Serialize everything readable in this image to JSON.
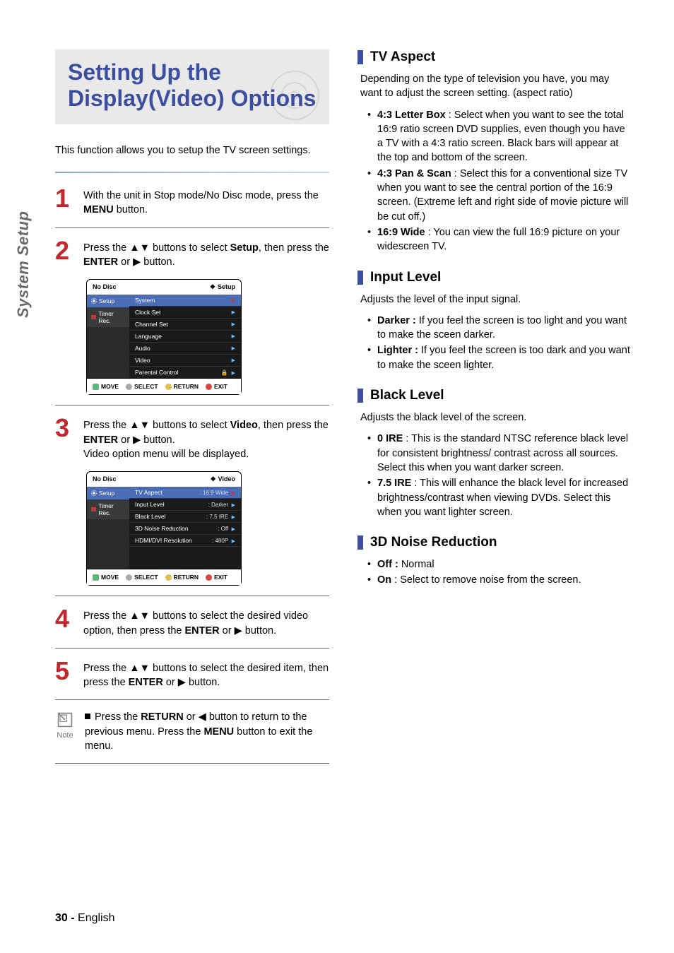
{
  "sideTab": "System Setup",
  "title": "Setting Up the Display(Video) Options",
  "intro": "This function allows you to setup the TV screen settings.",
  "steps": {
    "s1": {
      "num": "1",
      "pre": "With the unit in Stop mode/No Disc mode, press the ",
      "b1": "MENU",
      "post": " button."
    },
    "s2": {
      "num": "2",
      "pre": "Press the ",
      "arrows": "▲▼",
      "mid": " buttons to select ",
      "b1": "Setup",
      "mid2": ", then press the ",
      "b2": "ENTER",
      "or": " or ",
      "arrow2": "▶",
      "post": " button."
    },
    "s3": {
      "num": "3",
      "pre": "Press the ",
      "arrows": "▲▼",
      "mid": " buttons to select ",
      "b1": "Video",
      "mid2": ", then press the ",
      "b2": "ENTER",
      "or": " or ",
      "arrow2": "▶",
      "post": " button.",
      "line2": "Video option menu will be displayed."
    },
    "s4": {
      "num": "4",
      "pre": "Press the ",
      "arrows": "▲▼",
      "mid": " buttons to select the desired video option, then press the ",
      "b1": "ENTER",
      "or": " or ",
      "arrow2": "▶",
      "post": " button."
    },
    "s5": {
      "num": "5",
      "pre": "Press the ",
      "arrows": "▲▼",
      "mid": " buttons to select the desired item, then press the ",
      "b1": "ENTER",
      "or": " or ",
      "arrow2": "▶",
      "post": " button."
    }
  },
  "note": {
    "label": "Note",
    "pre": "Press the ",
    "b1": "RETURN",
    "or1": " or ",
    "arrow1": "◀",
    "mid": " button to return to the previous menu. Press the ",
    "b2": "MENU",
    "post": " button to exit the menu."
  },
  "osd1": {
    "headerLeft": "No Disc",
    "headerRight": "Setup",
    "leftItems": [
      "Setup",
      "Timer Rec."
    ],
    "rows": [
      {
        "label": "System",
        "sel": true
      },
      {
        "label": "Clock Set"
      },
      {
        "label": "Channel Set"
      },
      {
        "label": "Language"
      },
      {
        "label": "Audio"
      },
      {
        "label": "Video"
      },
      {
        "label": "Parental Control",
        "lock": true
      }
    ],
    "footer": [
      "MOVE",
      "SELECT",
      "RETURN",
      "EXIT"
    ]
  },
  "osd2": {
    "headerLeft": "No Disc",
    "headerRight": "Video",
    "leftItems": [
      "Setup",
      "Timer Rec."
    ],
    "rows": [
      {
        "label": "TV Aspect",
        "val": ": 16:9 Wide",
        "sel": true
      },
      {
        "label": "Input Level",
        "val": ": Darker"
      },
      {
        "label": "Black Level",
        "val": ": 7.5 IRE"
      },
      {
        "label": "3D Noise Reduction",
        "val": ": Off"
      },
      {
        "label": "HDMI/DVI Resolution",
        "val": ": 480P"
      }
    ],
    "footer": [
      "MOVE",
      "SELECT",
      "RETURN",
      "EXIT"
    ]
  },
  "right": {
    "tvAspect": {
      "title": "TV Aspect",
      "intro": "Depending on the type of television you have, you may want to adjust the screen setting. (aspect ratio)",
      "items": [
        {
          "b": "4:3 Letter Box",
          "t": " : Select when you want to see the total 16:9 ratio screen DVD supplies, even though you have a TV with a 4:3 ratio screen. Black bars will appear at the top and bottom of the screen."
        },
        {
          "b": "4:3 Pan & Scan",
          "t": " : Select this for a conventional size TV when you want to see the central portion of the 16:9 screen. (Extreme left and right side of movie picture will be cut off.)"
        },
        {
          "b": "16:9 Wide",
          "t": " : You can view the full 16:9 picture on your widescreen TV."
        }
      ]
    },
    "inputLevel": {
      "title": "Input Level",
      "intro": "Adjusts the level of the input signal.",
      "items": [
        {
          "b": "Darker :",
          "t": "  If you feel the screen is too light and you want to make the sceen darker."
        },
        {
          "b": "Lighter :",
          "t": "  If you feel the screen is too dark and you want to make the sceen lighter."
        }
      ]
    },
    "blackLevel": {
      "title": "Black Level",
      "intro": "Adjusts the black level of the screen.",
      "items": [
        {
          "b": "0 IRE",
          "t": " : This is the standard NTSC reference black level for consistent brightness/ contrast across all sources. Select this when you want darker screen."
        },
        {
          "b": "7.5 IRE",
          "t": " : This will  enhance the black level for increased brightness/contrast when viewing DVDs. Select this when you want lighter screen."
        }
      ]
    },
    "noise": {
      "title": "3D Noise Reduction",
      "items": [
        {
          "b": "Off :",
          "t": " Normal"
        },
        {
          "b": "On",
          "t": " : Select to remove noise from the screen."
        }
      ]
    }
  },
  "footer": {
    "page": "30 - ",
    "lang": "English"
  }
}
